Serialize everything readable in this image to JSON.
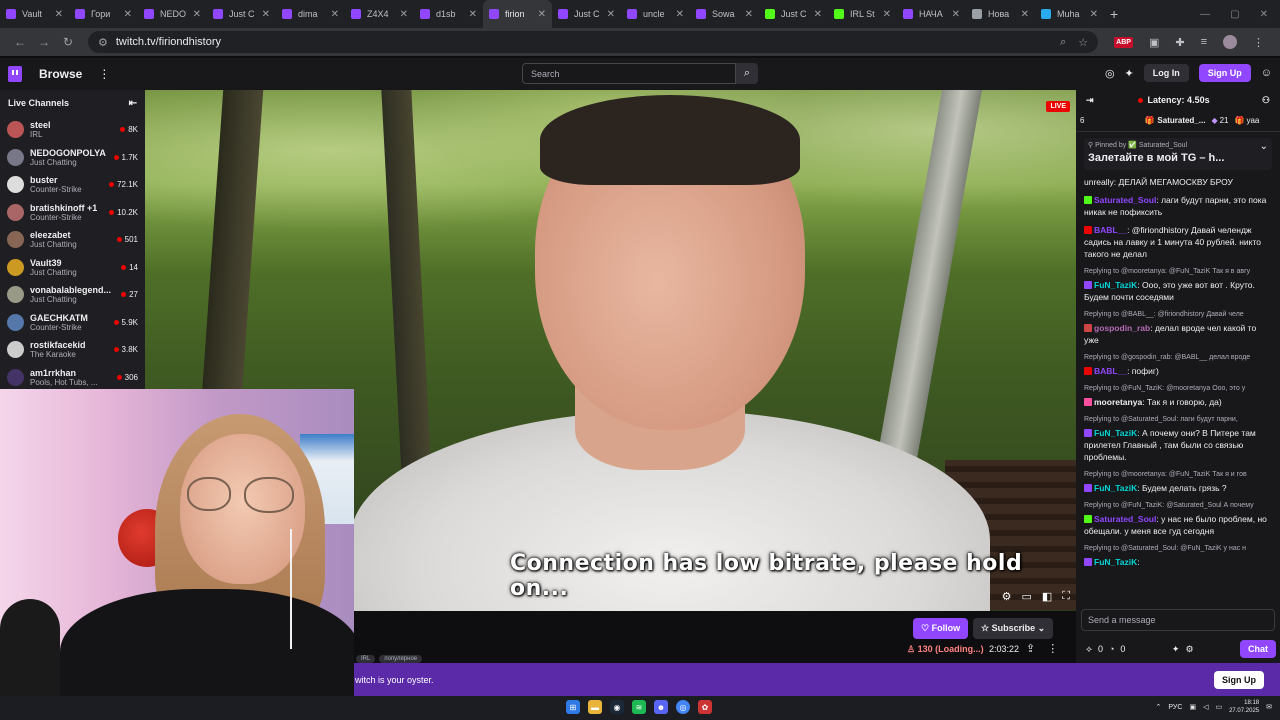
{
  "browser": {
    "tabs": [
      {
        "label": "Vault",
        "color": "#9147ff"
      },
      {
        "label": "Гори",
        "color": "#9147ff"
      },
      {
        "label": "NEDO",
        "color": "#9147ff"
      },
      {
        "label": "Just C",
        "color": "#9147ff"
      },
      {
        "label": "dima",
        "color": "#9147ff"
      },
      {
        "label": "Z4X4",
        "color": "#9147ff"
      },
      {
        "label": "d1sb",
        "color": "#9147ff"
      },
      {
        "label": "firion",
        "color": "#9147ff",
        "active": true
      },
      {
        "label": "Just C",
        "color": "#9147ff"
      },
      {
        "label": "uncle",
        "color": "#9147ff"
      },
      {
        "label": "Sowa",
        "color": "#9147ff"
      },
      {
        "label": "Just C",
        "color": "#53fc18"
      },
      {
        "label": "IRL St",
        "color": "#53fc18"
      },
      {
        "label": "НАЧА",
        "color": "#9147ff"
      },
      {
        "label": "Нова",
        "color": "#9aa0a6"
      },
      {
        "label": "Muha",
        "color": "#2aabee"
      }
    ],
    "url": "twitch.tv/firiondhistory"
  },
  "nav": {
    "browse": "Browse",
    "search_placeholder": "Search",
    "login": "Log In",
    "signup": "Sign Up"
  },
  "sidebar": {
    "title": "Live Channels",
    "channels": [
      {
        "name": "steel",
        "category": "IRL",
        "viewers": "8K",
        "color": "#b55"
      },
      {
        "name": "NEDOGONPOLYA",
        "category": "Just Chatting",
        "viewers": "1.7K",
        "color": "#778"
      },
      {
        "name": "buster",
        "category": "Counter-Strike",
        "viewers": "72.1K",
        "color": "#ddd"
      },
      {
        "name": "bratishkinoff +1",
        "category": "Counter-Strike",
        "viewers": "10.2K",
        "color": "#a66"
      },
      {
        "name": "eleezabet",
        "category": "Just Chatting",
        "viewers": "501",
        "color": "#865"
      },
      {
        "name": "Vault39",
        "category": "Just Chatting",
        "viewers": "14",
        "color": "#c92"
      },
      {
        "name": "vonabalablegend...",
        "category": "Just Chatting",
        "viewers": "27",
        "color": "#998"
      },
      {
        "name": "GAECHKATM",
        "category": "Counter-Strike",
        "viewers": "5.9K",
        "color": "#57a"
      },
      {
        "name": "rostikfacekid",
        "category": "The Karaoke",
        "viewers": "3.8K",
        "color": "#ccc"
      },
      {
        "name": "am1rrkhan",
        "category": "Pools, Hot Tubs, ...",
        "viewers": "306",
        "color": "#436"
      }
    ]
  },
  "video": {
    "live_label": "LIVE",
    "overlay_text": "Connection has low bitrate, please hold on..."
  },
  "stream_info": {
    "follow": "Follow",
    "subscribe": "Subscribe",
    "viewers": "130 (Loading...)",
    "uptime": "2:03:22",
    "tags": [
      "IRL",
      "популярное"
    ]
  },
  "banner": {
    "text": "witch is your oyster.",
    "button": "Sign Up"
  },
  "chat": {
    "latency": "Latency: 4.50s",
    "gift_left": "6",
    "gift_user": "Saturated_...",
    "gift_count": "21",
    "gift_right": "yaa",
    "pinned_by": "Pinned by ✅ Saturated_Soul",
    "pinned_msg": "Залетайте в мой TG – h...",
    "messages": [
      {
        "reply": "",
        "user": "",
        "user_color": "#bf94ff",
        "text": "unreally: ДЕЛАЙ МЕГАМОСКВУ БРОУ"
      },
      {
        "reply": "",
        "user": "Saturated_Soul",
        "user_color": "#9147ff",
        "text": "лаги будут парни, это пока никак не пофиксить",
        "badge": "#53fc18"
      },
      {
        "reply": "",
        "user": "BABL__",
        "user_color": "#9147ff",
        "text": "@firiondhistory Давай челендж садись на лавку и 1 минута 40 рублей. никто такого не делал",
        "badge": "#eb0400"
      },
      {
        "reply": "Replying to @mooretanya: @FuN_TaziK Так я в авгу",
        "user": "FuN_TaziK",
        "user_color": "#00d6d6",
        "text": "Ооо, это уже вот вот . Круто. Будем почти соседями",
        "badge": "#9147ff"
      },
      {
        "reply": "Replying to @BABL__: @firiondhistory Давай челе",
        "user": "gospodin_rab",
        "user_color": "#b46bb3",
        "text": "делал вроде чел какой то уже",
        "badge": "#c44"
      },
      {
        "reply": "Replying to @gospodin_rab: @BABL__ делал вроде",
        "user": "BABL__",
        "user_color": "#9147ff",
        "text": "пофиг)",
        "badge": "#eb0400"
      },
      {
        "reply": "Replying to @FuN_TaziK: @mooretanya Ооо, это у",
        "user": "mooretanya",
        "user_color": "#efeff1",
        "text": "Так я и говорю, да)",
        "badge": "#ff4fa0"
      },
      {
        "reply": "Replying to @Saturated_Soul: лаги будут парни, ",
        "user": "FuN_TaziK",
        "user_color": "#00d6d6",
        "text": "А почему они? В Питере там прилетел Главный , там были со связью проблемы.",
        "badge": "#9147ff"
      },
      {
        "reply": "Replying to @mooretanya: @FuN_TaziK Так я и гов",
        "user": "FuN_TaziK",
        "user_color": "#00d6d6",
        "text": "Будем делать грязь ?",
        "badge": "#9147ff"
      },
      {
        "reply": "Replying to @FuN_TaziK: @Saturated_Soul А почему",
        "user": "Saturated_Soul",
        "user_color": "#9147ff",
        "text": "у нас не было проблем, но обещали. у меня все гуд сегодня",
        "badge": "#53fc18"
      },
      {
        "reply": "Replying to @Saturated_Soul: @FuN_TaziK у нас н",
        "user": "FuN_TaziK",
        "user_color": "#00d6d6",
        "text": "",
        "badge": "#9147ff"
      }
    ],
    "input_placeholder": "Send a message",
    "points": "0",
    "points2": "0",
    "chat_button": "Chat"
  },
  "taskbar": {
    "lang": "РУС",
    "time": "18:18",
    "date": "27.07.2025"
  }
}
